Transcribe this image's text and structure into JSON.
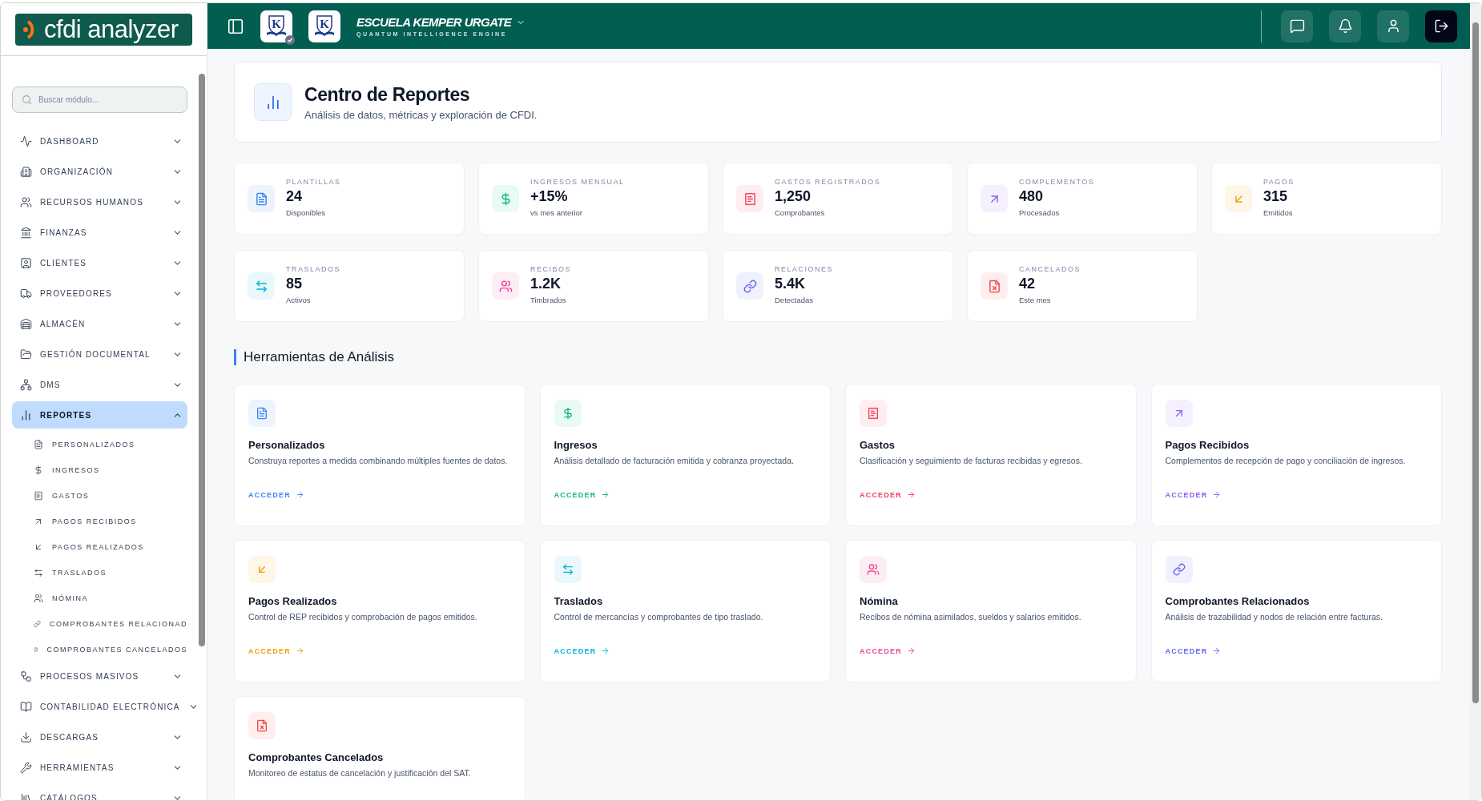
{
  "logo": {
    "text": "cfdi analyzer"
  },
  "sidebar": {
    "search": {
      "placeholder": "Buscar módulo..."
    },
    "items": [
      {
        "label": "DASHBOARD",
        "selected": false,
        "expanded": false
      },
      {
        "label": "ORGANIZACIÓN",
        "selected": false,
        "expanded": false
      },
      {
        "label": "RECURSOS HUMANOS",
        "selected": false,
        "expanded": false
      },
      {
        "label": "FINANZAS",
        "selected": false,
        "expanded": false
      },
      {
        "label": "CLIENTES",
        "selected": false,
        "expanded": false
      },
      {
        "label": "PROVEEDORES",
        "selected": false,
        "expanded": false
      },
      {
        "label": "ALMACÉN",
        "selected": false,
        "expanded": false
      },
      {
        "label": "GESTIÓN DOCUMENTAL",
        "selected": false,
        "expanded": false
      },
      {
        "label": "DMS",
        "selected": false,
        "expanded": false
      },
      {
        "label": "REPORTES",
        "selected": true,
        "expanded": true,
        "children": [
          {
            "label": "PERSONALIZADOS"
          },
          {
            "label": "INGRESOS"
          },
          {
            "label": "GASTOS"
          },
          {
            "label": "PAGOS RECIBIDOS"
          },
          {
            "label": "PAGOS REALIZADOS"
          },
          {
            "label": "TRASLADOS"
          },
          {
            "label": "NÓMINA"
          },
          {
            "label": "COMPROBANTES RELACIONAD"
          },
          {
            "label": "COMPROBANTES CANCELADOS"
          }
        ]
      },
      {
        "label": "PROCESOS MASIVOS",
        "selected": false,
        "expanded": false
      },
      {
        "label": "CONTABILIDAD ELECTRÓNICA",
        "selected": false,
        "expanded": false
      },
      {
        "label": "DESCARGAS",
        "selected": false,
        "expanded": false
      },
      {
        "label": "HERRAMIENTAS",
        "selected": false,
        "expanded": false
      },
      {
        "label": "CATÁLOGOS",
        "selected": false,
        "expanded": false
      }
    ]
  },
  "header": {
    "badge_letters": [
      "K",
      "K"
    ],
    "org_title": "ESCUELA KEMPER URGATE",
    "org_subtitle": "QUANTUM INTELLIGENCE ENGINE"
  },
  "page_header": {
    "title": "Centro de Reportes",
    "subtitle": "Análisis de datos, métricas y exploración de CFDI."
  },
  "stats": [
    {
      "label": "PLANTILLAS",
      "value": "24",
      "caption": "Disponibles",
      "color": "#3b82f6"
    },
    {
      "label": "INGRESOS MENSUAL",
      "value": "+15%",
      "caption": "vs mes anterior",
      "color": "#10b981"
    },
    {
      "label": "GASTOS REGISTRADOS",
      "value": "1,250",
      "caption": "Comprobantes",
      "color": "#f43f5e"
    },
    {
      "label": "COMPLEMENTOS",
      "value": "480",
      "caption": "Procesados",
      "color": "#8b5cf6"
    },
    {
      "label": "PAGOS",
      "value": "315",
      "caption": "Emitidos",
      "color": "#f59e0b"
    },
    {
      "label": "TRASLADOS",
      "value": "85",
      "caption": "Activos",
      "color": "#06b6d4"
    },
    {
      "label": "RECIBOS",
      "value": "1.2K",
      "caption": "Timbrados",
      "color": "#ec4899"
    },
    {
      "label": "RELACIONES",
      "value": "5.4K",
      "caption": "Detectadas",
      "color": "#6366f1"
    },
    {
      "label": "CANCELADOS",
      "value": "42",
      "caption": "Este mes",
      "color": "#ef4444"
    }
  ],
  "section_title": "Herramientas de Análisis",
  "tools": [
    {
      "title": "Personalizados",
      "description": "Construya reportes a medida combinando múltiples fuentes de datos.",
      "link": "ACCEDER",
      "color": "#3b82f6"
    },
    {
      "title": "Ingresos",
      "description": "Análisis detallado de facturación emitida y cobranza proyectada.",
      "link": "ACCEDER",
      "color": "#10b981"
    },
    {
      "title": "Gastos",
      "description": "Clasificación y seguimiento de facturas recibidas y egresos.",
      "link": "ACCEDER",
      "color": "#f43f5e"
    },
    {
      "title": "Pagos Recibidos",
      "description": "Complementos de recepción de pago y conciliación de ingresos.",
      "link": "ACCEDER",
      "color": "#8b5cf6"
    },
    {
      "title": "Pagos Realizados",
      "description": "Control de REP recibidos y comprobación de pagos emitidos.",
      "link": "ACCEDER",
      "color": "#f59e0b"
    },
    {
      "title": "Traslados",
      "description": "Control de mercancías y comprobantes de tipo traslado.",
      "link": "ACCEDER",
      "color": "#06b6d4"
    },
    {
      "title": "Nómina",
      "description": "Recibos de nómina asimilados, sueldos y salarios emitidos.",
      "link": "ACCEDER",
      "color": "#ec4899"
    },
    {
      "title": "Comprobantes Relacionados",
      "description": "Análisis de trazabilidad y nodos de relación entre facturas.",
      "link": "ACCEDER",
      "color": "#6366f1"
    },
    {
      "title": "Comprobantes Cancelados",
      "description": "Monitoreo de estatus de cancelación y justificación del SAT.",
      "color": "#ef4444"
    }
  ]
}
